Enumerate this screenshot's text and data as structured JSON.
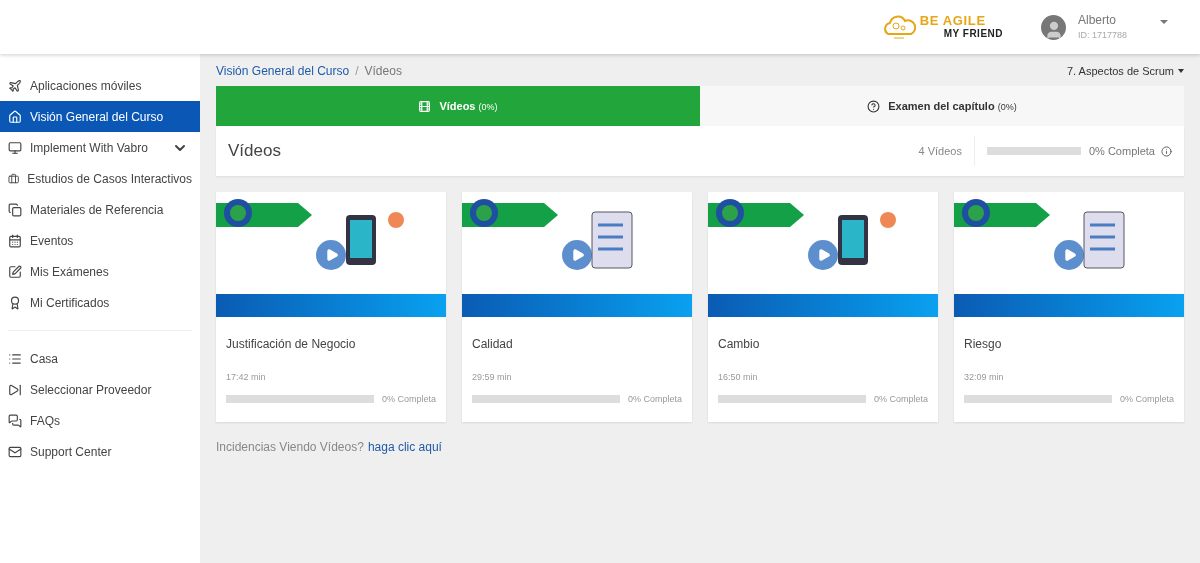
{
  "header": {
    "logo": {
      "line_1": "BE AGILE",
      "line_2": "MY FRIEND"
    },
    "user": {
      "name": "Alberto",
      "id": "ID: 1717788"
    }
  },
  "sidebar": {
    "items": [
      {
        "label": "Aplicaciones móviles",
        "selected": false,
        "expandable": false
      },
      {
        "label": "Visión General del Curso",
        "selected": true,
        "expandable": false
      },
      {
        "label": "Implement With Vabro",
        "selected": false,
        "expandable": true
      },
      {
        "label": "Estudios de Casos Interactivos",
        "selected": false,
        "expandable": false
      },
      {
        "label": "Materiales de Referencia",
        "selected": false,
        "expandable": false
      },
      {
        "label": "Eventos",
        "selected": false,
        "expandable": false
      },
      {
        "label": "Mis Exámenes",
        "selected": false,
        "expandable": false
      },
      {
        "label": "Mi Certificados",
        "selected": false,
        "expandable": false
      }
    ],
    "secondary_items": [
      {
        "label": "Casa",
        "selected": false
      },
      {
        "label": "Seleccionar Proveedor",
        "selected": false
      },
      {
        "label": "FAQs",
        "selected": false
      },
      {
        "label": "Support Center",
        "selected": false
      }
    ]
  },
  "breadcrumb": {
    "items": [
      "Visión General del Curso",
      "Vídeos"
    ],
    "separator": "/"
  },
  "chapter_menu": "7. Aspectos de Scrum",
  "tabs": [
    {
      "label": "Vídeos",
      "count": "(0%)",
      "selected": true
    },
    {
      "label": "Examen del capítulo",
      "count": "(0%)",
      "selected": false
    }
  ],
  "section": {
    "title": "Vídeos",
    "count": "4 Vídeos",
    "level": 0,
    "progress": "0% Completa"
  },
  "videos": [
    {
      "title": "Justificación de Negocio",
      "duration": "17:42 min",
      "level": 0,
      "progress": "0% Completa"
    },
    {
      "title": "Calidad",
      "duration": "29:59 min",
      "level": 0,
      "progress": "0% Completa"
    },
    {
      "title": "Cambio",
      "duration": "16:50 min",
      "level": 0,
      "progress": "0% Completa"
    },
    {
      "title": "Riesgo",
      "duration": "32:09 min",
      "level": 0,
      "progress": "0% Completa"
    }
  ],
  "help": {
    "text": "Incidencias Viendo Vídeos?",
    "link": "haga clic aquí"
  }
}
